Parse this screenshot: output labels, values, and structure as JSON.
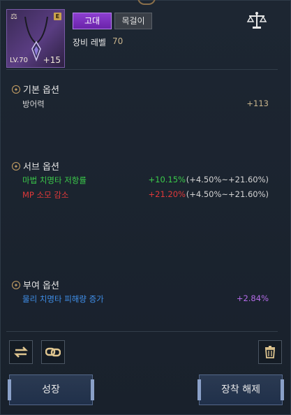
{
  "item": {
    "level_label": "LV.70",
    "enhance": "+15",
    "grade": "고대",
    "type": "목걸이",
    "equip_level_label": "장비 레벨",
    "equip_level_value": "70",
    "lock_badge": "E"
  },
  "sections": {
    "basic": {
      "title": "기본 옵션",
      "rows": [
        {
          "name": "방어력",
          "value": "+113"
        }
      ]
    },
    "sub": {
      "title": "서브 옵션",
      "rows": [
        {
          "name": "마법 치명타 저항률",
          "value": "+10.15%",
          "range": "(+4.50%~+21.60%)"
        },
        {
          "name": "MP 소모 감소",
          "value": "+21.20%",
          "range": "(+4.50%~+21.60%)"
        }
      ]
    },
    "grant": {
      "title": "부여 옵션",
      "rows": [
        {
          "name": "물리 치명타 피해량 증가",
          "value": "+2.84%"
        }
      ]
    }
  },
  "buttons": {
    "grow": "성장",
    "unequip": "장착 해제"
  },
  "icons": {
    "scale": "scale-icon",
    "swap": "swap-icon",
    "link": "link-icon",
    "trash": "trash-icon",
    "section": "section-emblem-icon"
  },
  "colors": {
    "grade": "#8d3fd1",
    "sub_positive": "#3bcb4a",
    "sub_negative": "#e0393a",
    "grant_name": "#3f8ee8",
    "grant_value": "#b46be8"
  }
}
